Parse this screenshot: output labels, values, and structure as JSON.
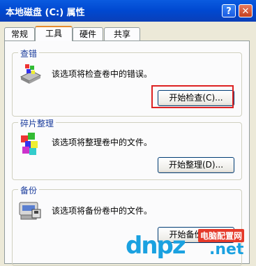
{
  "window": {
    "title": "本地磁盘 (C:) 属性",
    "help_label": "?",
    "close_label": "✕"
  },
  "tabs": [
    "常规",
    "工具",
    "硬件",
    "共享"
  ],
  "active_tab": "工具",
  "groups": {
    "check": {
      "title": "查错",
      "description": "该选项将检查卷中的错误。",
      "button": "开始检查(C)..."
    },
    "defrag": {
      "title": "碎片整理",
      "description": "该选项将整理卷中的文件。",
      "button": "开始整理(D)..."
    },
    "backup": {
      "title": "备份",
      "description": "该选项将备份卷中的文件。",
      "button": "开始备份(B)..."
    }
  },
  "watermark": {
    "main": "dnpz",
    "badge": "电脑配置网",
    "suffix": ".net"
  },
  "colors": {
    "accent_title_bar": "#0048d0",
    "highlight": "#dd2222",
    "group_title": "#1a3c9c"
  }
}
